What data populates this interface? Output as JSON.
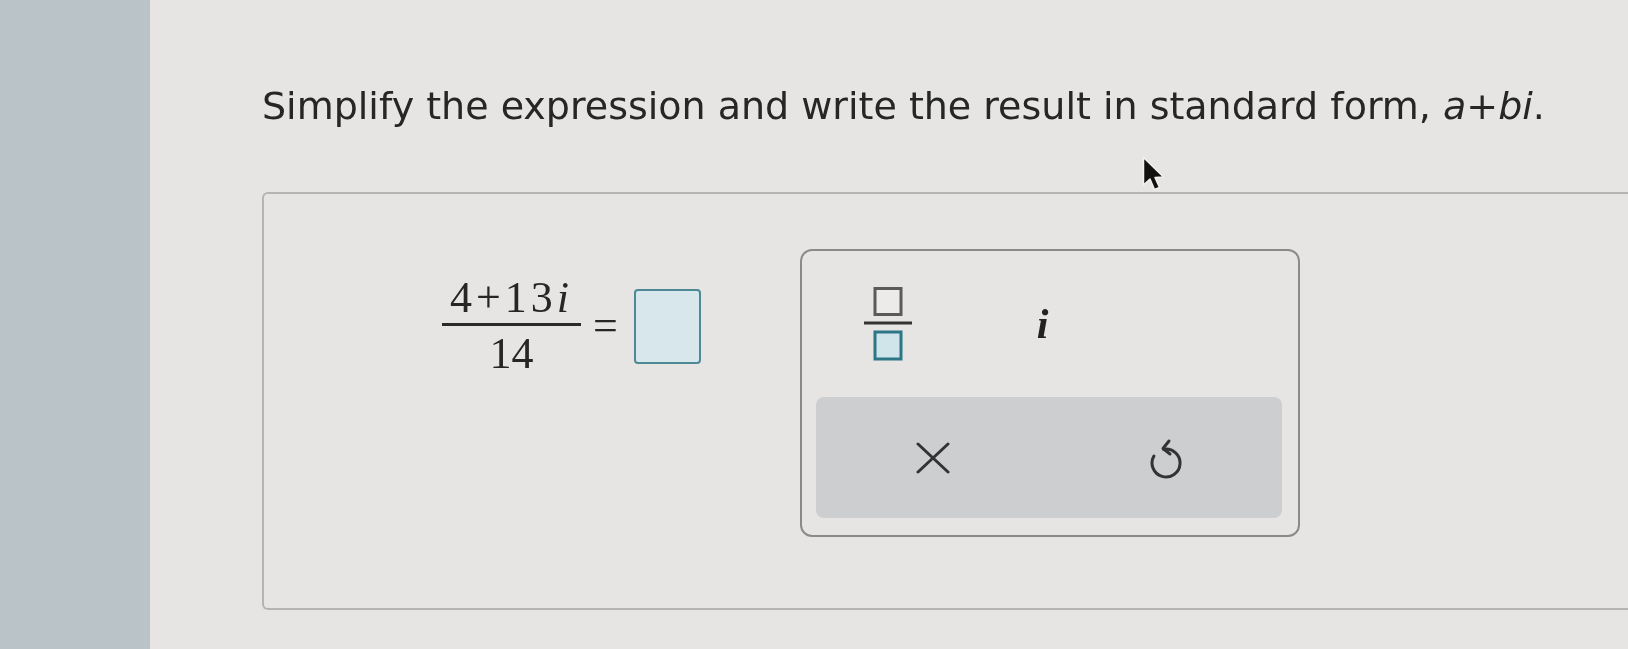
{
  "instruction": "Simplify the expression and write the result in standard form, *a*+*bi*.",
  "expression": {
    "numerator": {
      "terms": "4+13",
      "unit": "i"
    },
    "denominator": "14",
    "relation": "="
  },
  "palette": {
    "templates": [
      {
        "kind": "fraction"
      },
      {
        "kind": "symbol",
        "label": "i"
      }
    ],
    "actions": [
      {
        "kind": "clear"
      },
      {
        "kind": "undo"
      }
    ]
  }
}
